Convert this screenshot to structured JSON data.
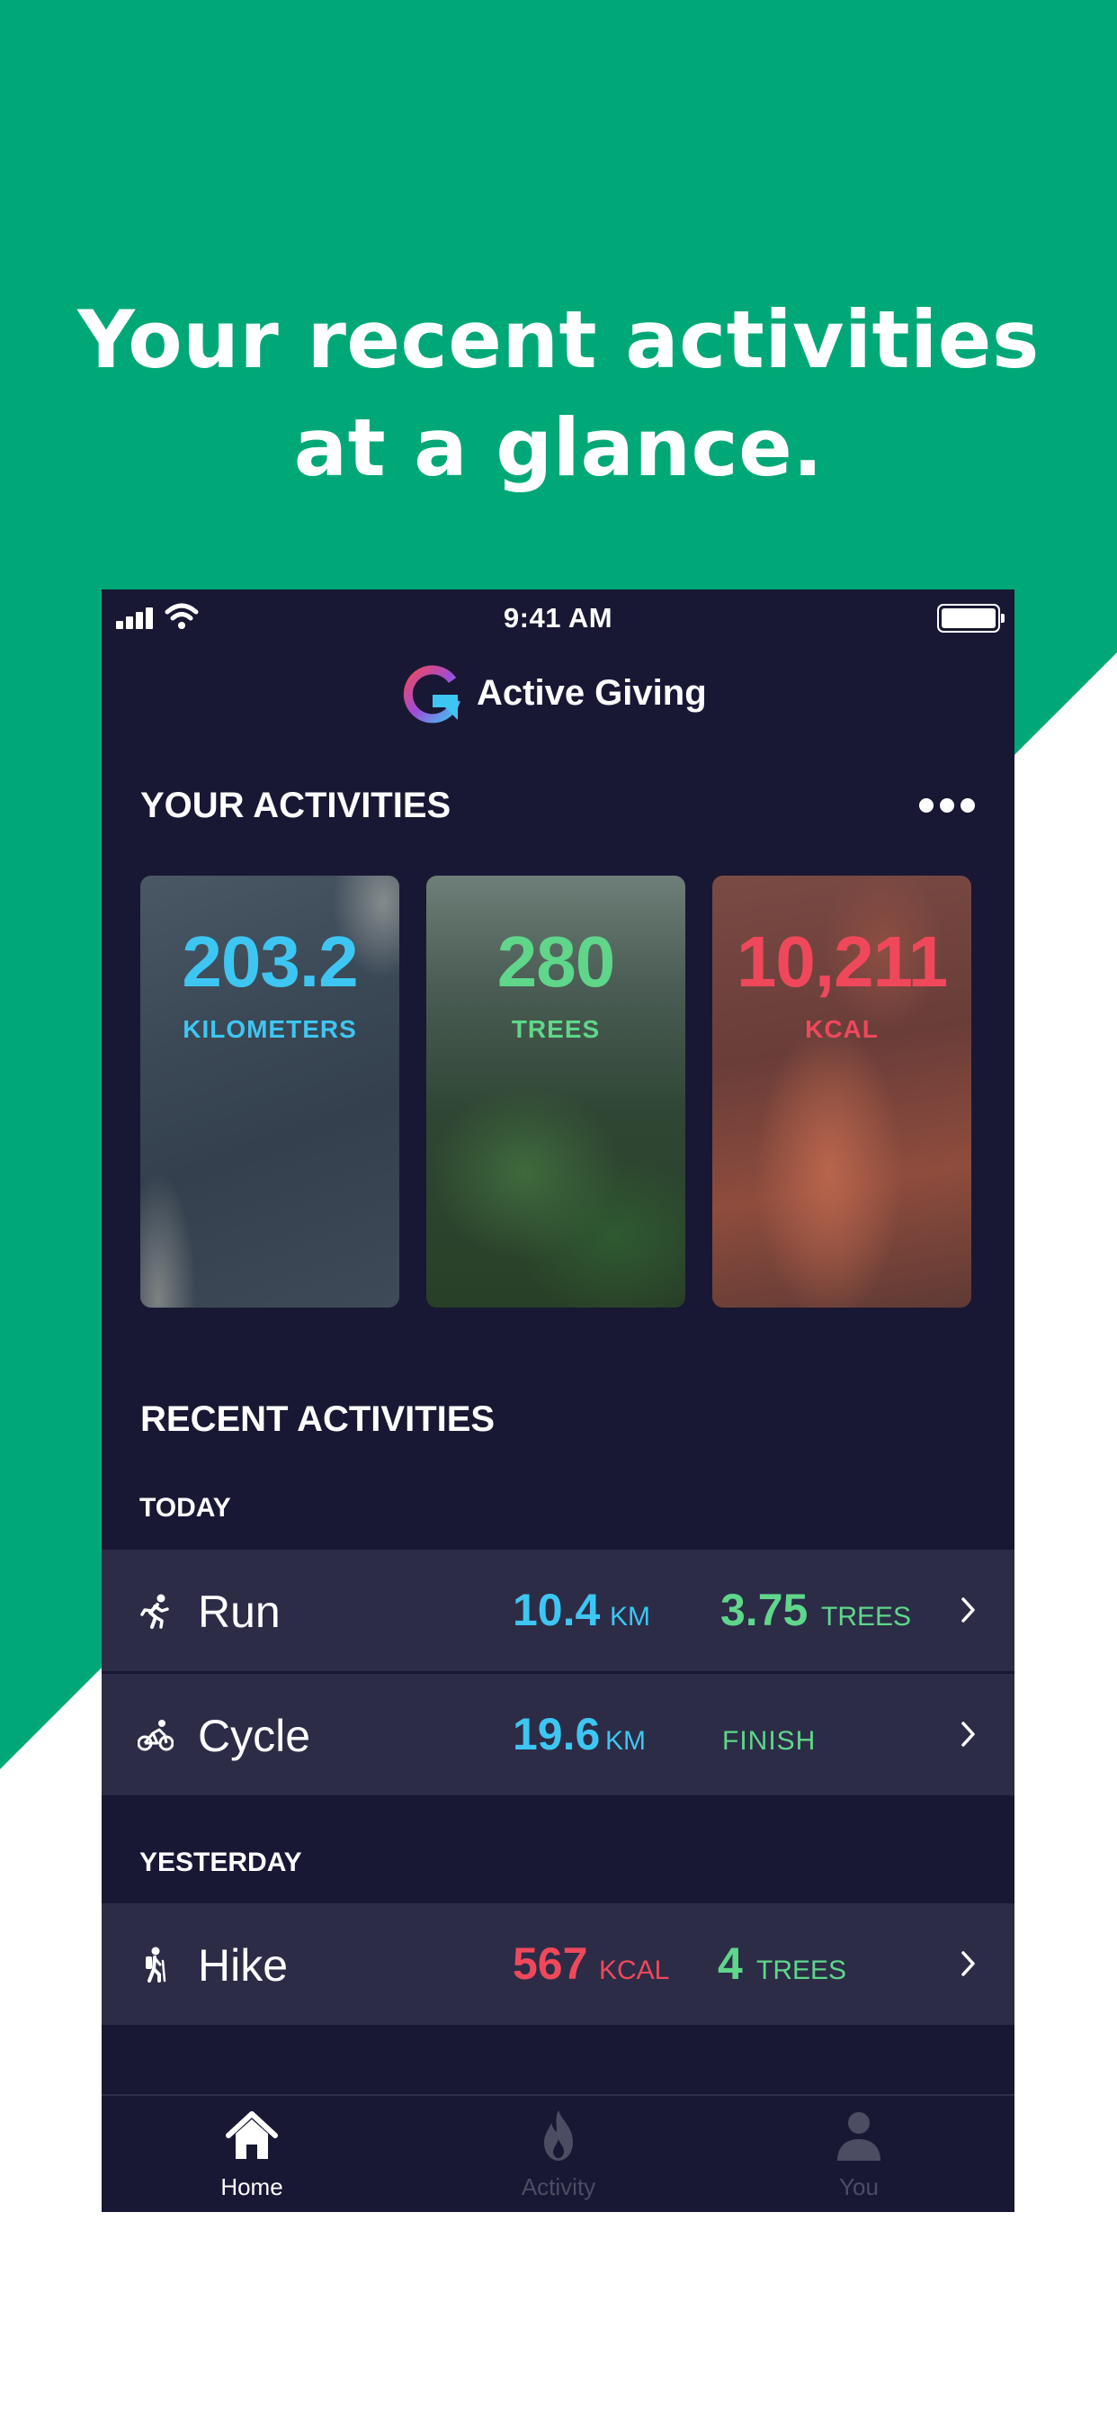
{
  "colors": {
    "brand_green": "#00a877",
    "phone_bg": "#181834",
    "row_bg": "#2c2c47",
    "km_blue": "#3ec6f2",
    "trees_green": "#5fd68a",
    "kcal_red": "#f0485b"
  },
  "headline": {
    "line1": "Your recent activities",
    "line2": "at a glance."
  },
  "status_bar": {
    "time": "9:41 AM"
  },
  "app": {
    "title": "Active Giving"
  },
  "your_activities": {
    "title": "YOUR ACTIVITIES",
    "cards": [
      {
        "value": "203.2",
        "unit": "KILOMETERS"
      },
      {
        "value": "280",
        "unit": "TREES"
      },
      {
        "value": "10,211",
        "unit": "KCAL"
      }
    ]
  },
  "recent_activities": {
    "title": "RECENT ACTIVITIES",
    "groups": [
      {
        "label": "TODAY",
        "rows": [
          {
            "icon": "run-icon",
            "name": "Run",
            "metric_value": "10.4",
            "metric_unit": "KM",
            "trees_value": "3.75",
            "trees_unit": "TREES"
          },
          {
            "icon": "cycle-icon",
            "name": "Cycle",
            "metric_value": "19.6",
            "metric_unit": "KM",
            "status": "FINISH"
          }
        ]
      },
      {
        "label": "YESTERDAY",
        "rows": [
          {
            "icon": "hike-icon",
            "name": "Hike",
            "metric_value": "567",
            "metric_unit": "KCAL",
            "trees_value": "4",
            "trees_unit": "TREES"
          }
        ]
      }
    ]
  },
  "tab_bar": {
    "tabs": [
      {
        "label": "Home",
        "icon": "home-icon",
        "active": true
      },
      {
        "label": "Activity",
        "icon": "flame-icon",
        "active": false
      },
      {
        "label": "You",
        "icon": "user-icon",
        "active": false
      }
    ]
  }
}
